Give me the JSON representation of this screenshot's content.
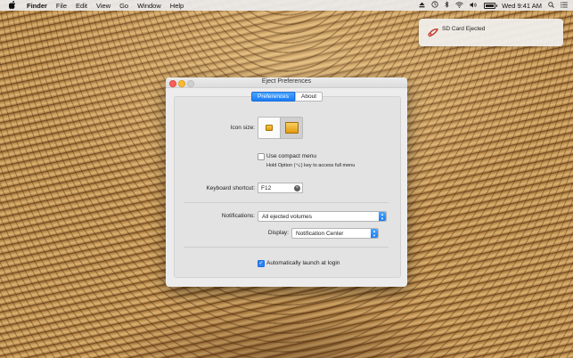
{
  "menubar": {
    "apple": "",
    "app_name": "Finder",
    "menus": [
      "File",
      "Edit",
      "View",
      "Go",
      "Window",
      "Help"
    ],
    "clock": "Wed 9:41 AM"
  },
  "notification": {
    "text": "SD Card Ejected"
  },
  "window": {
    "title": "Eject Preferences",
    "tabs": [
      "Preferences",
      "About"
    ],
    "icon_size_label": "Icon size:",
    "compact_menu_label": "Use compact menu",
    "compact_menu_hint": "Hold Option (⌥) key to access full menu",
    "shortcut_label": "Keyboard shortcut:",
    "shortcut_value": "F12",
    "notifications_label": "Notifications:",
    "notifications_value": "All ejected volumes",
    "display_label": "Display:",
    "display_value": "Notification Center",
    "autolaunch_label": "Automatically launch at login"
  },
  "state": {
    "compact_menu_checked": false,
    "autolaunch_checked": true,
    "icon_size_selected": "large"
  },
  "colors": {
    "accent": "#1a7cf5",
    "close": "#fc5f57",
    "minimize": "#fdbc2e"
  }
}
